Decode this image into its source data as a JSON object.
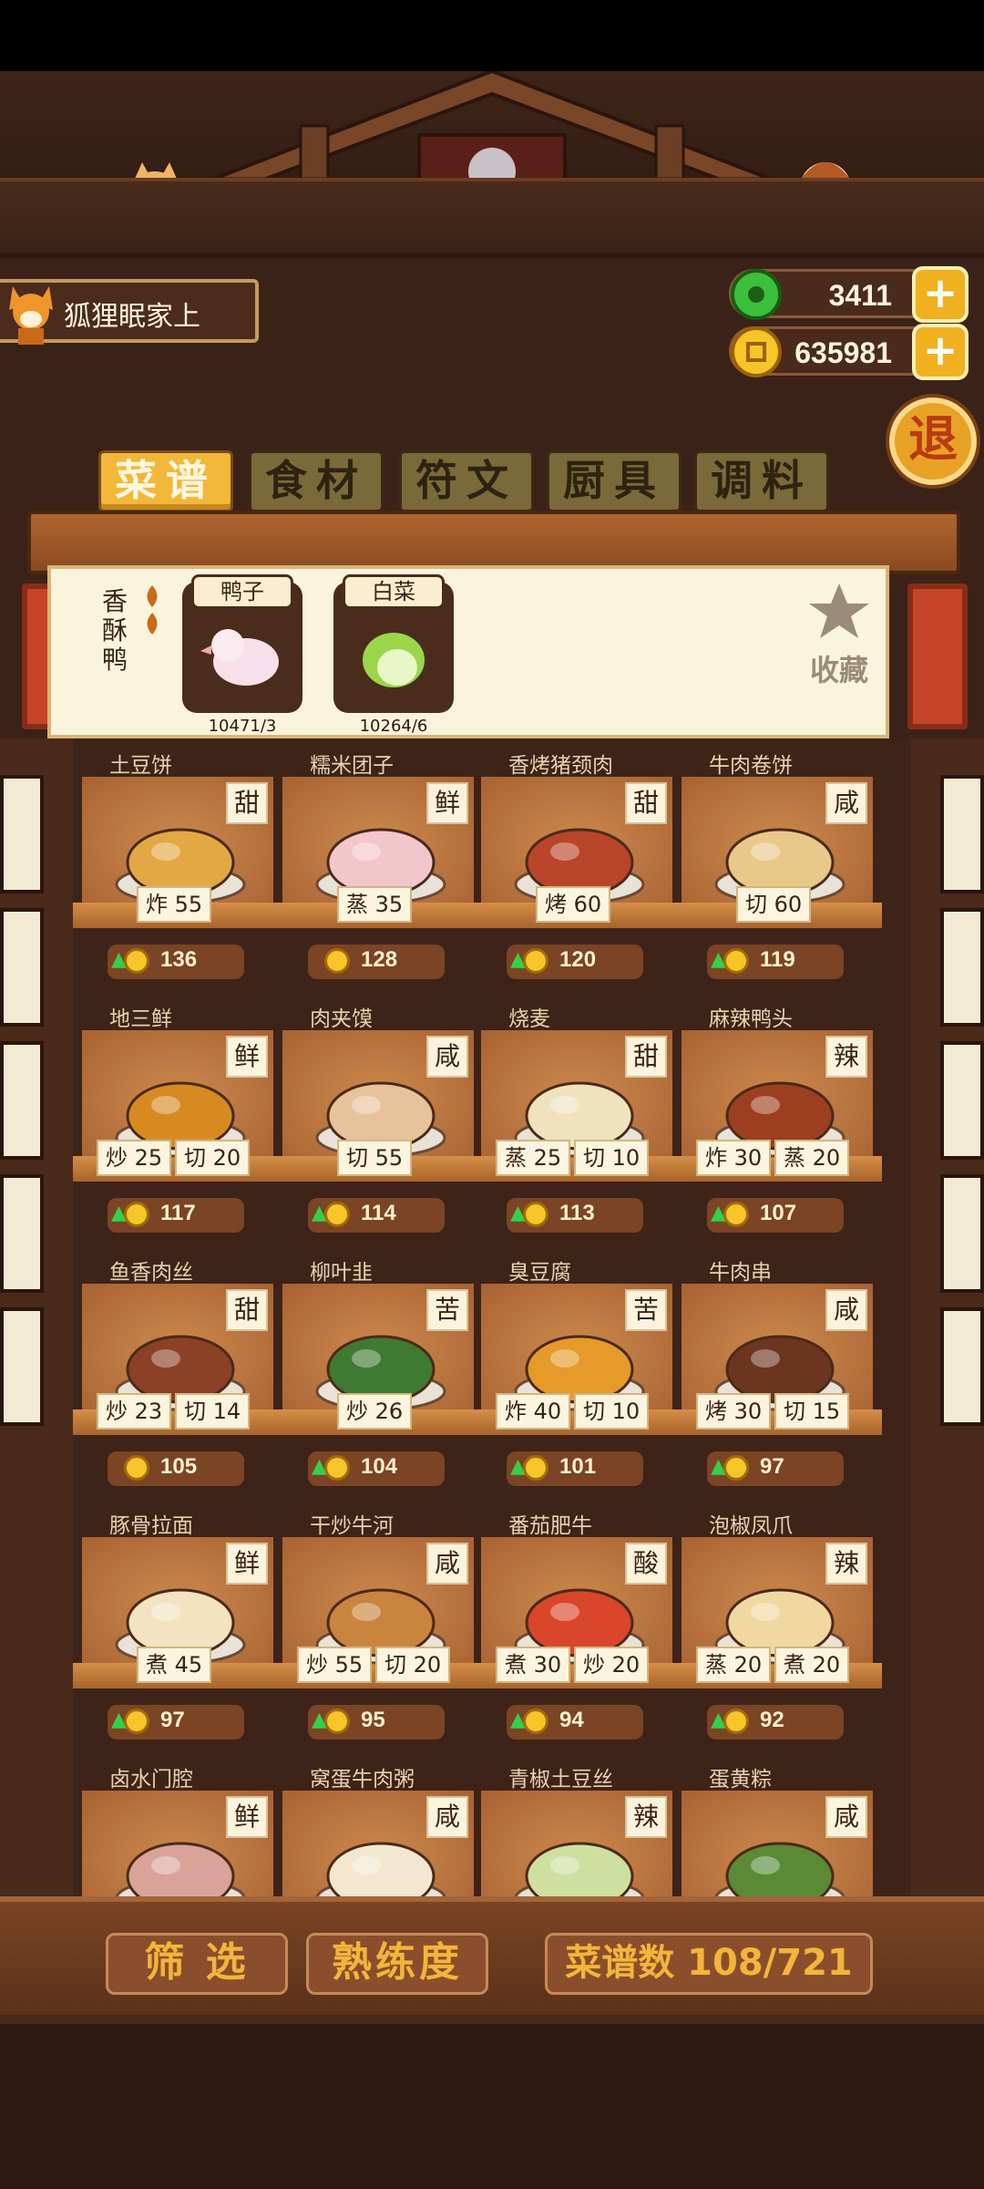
{
  "shop": {
    "name": "狐狸眠家上"
  },
  "currency": {
    "gems": "3411",
    "coins": "635981",
    "add_label": "+"
  },
  "exit_label": "退",
  "tabs": [
    {
      "label": "菜谱",
      "active": true
    },
    {
      "label": "食材",
      "active": false
    },
    {
      "label": "符文",
      "active": false
    },
    {
      "label": "厨具",
      "active": false
    },
    {
      "label": "调料",
      "active": false
    }
  ],
  "selected": {
    "dish": "香酥鸭",
    "ingredients": [
      {
        "name": "鸭子",
        "count": "10471/3",
        "icon": "duck-icon"
      },
      {
        "name": "白菜",
        "count": "10264/6",
        "icon": "cabbage-icon"
      }
    ],
    "favorite_label": "收藏"
  },
  "recipes": [
    {
      "name": "土豆饼",
      "flavor": "甜",
      "tags": [
        "炸 55"
      ],
      "price": "136",
      "up": true,
      "color": "#e2a843"
    },
    {
      "name": "糯米团子",
      "flavor": "鲜",
      "tags": [
        "蒸 35"
      ],
      "price": "128",
      "up": false,
      "color": "#f2c7cc"
    },
    {
      "name": "香烤猪颈肉",
      "flavor": "甜",
      "tags": [
        "烤 60"
      ],
      "price": "120",
      "up": true,
      "color": "#b8452a"
    },
    {
      "name": "牛肉卷饼",
      "flavor": "咸",
      "tags": [
        "切 60"
      ],
      "price": "119",
      "up": true,
      "color": "#e9c98a"
    },
    {
      "name": "地三鲜",
      "flavor": "鲜",
      "tags": [
        "炒 25",
        "切 20"
      ],
      "price": "117",
      "up": true,
      "color": "#d88a22"
    },
    {
      "name": "肉夹馍",
      "flavor": "咸",
      "tags": [
        "切 55"
      ],
      "price": "114",
      "up": true,
      "color": "#e6c39a"
    },
    {
      "name": "烧麦",
      "flavor": "甜",
      "tags": [
        "蒸 25",
        "切 10"
      ],
      "price": "113",
      "up": true,
      "color": "#efe2bd"
    },
    {
      "name": "麻辣鸭头",
      "flavor": "辣",
      "tags": [
        "炸 30",
        "蒸 20"
      ],
      "price": "107",
      "up": true,
      "color": "#9c3f1f"
    },
    {
      "name": "鱼香肉丝",
      "flavor": "甜",
      "tags": [
        "炒 23",
        "切 14"
      ],
      "price": "105",
      "up": false,
      "color": "#8a4126"
    },
    {
      "name": "柳叶韭",
      "flavor": "苦",
      "tags": [
        "炒 26"
      ],
      "price": "104",
      "up": true,
      "color": "#3f7a32"
    },
    {
      "name": "臭豆腐",
      "flavor": "苦",
      "tags": [
        "炸 40",
        "切 10"
      ],
      "price": "101",
      "up": true,
      "color": "#e59a2a"
    },
    {
      "name": "牛肉串",
      "flavor": "咸",
      "tags": [
        "烤 30",
        "切 15"
      ],
      "price": "97",
      "up": true,
      "color": "#6b3520"
    },
    {
      "name": "豚骨拉面",
      "flavor": "鲜",
      "tags": [
        "煮 45"
      ],
      "price": "97",
      "up": true,
      "color": "#f3e3c0"
    },
    {
      "name": "干炒牛河",
      "flavor": "咸",
      "tags": [
        "炒 55",
        "切 20"
      ],
      "price": "95",
      "up": true,
      "color": "#c9843e"
    },
    {
      "name": "番茄肥牛",
      "flavor": "酸",
      "tags": [
        "煮 30",
        "炒 20"
      ],
      "price": "94",
      "up": true,
      "color": "#d9462a"
    },
    {
      "name": "泡椒凤爪",
      "flavor": "辣",
      "tags": [
        "蒸 20",
        "煮 20"
      ],
      "price": "92",
      "up": true,
      "color": "#f0d9a0"
    },
    {
      "name": "卤水门腔",
      "flavor": "鲜",
      "tags": [],
      "price": "",
      "up": false,
      "color": "#d9a39a"
    },
    {
      "name": "窝蛋牛肉粥",
      "flavor": "咸",
      "tags": [],
      "price": "",
      "up": false,
      "color": "#f3e8cf"
    },
    {
      "name": "青椒土豆丝",
      "flavor": "辣",
      "tags": [],
      "price": "",
      "up": false,
      "color": "#cde0a0"
    },
    {
      "name": "蛋黄粽",
      "flavor": "咸",
      "tags": [],
      "price": "",
      "up": false,
      "color": "#5a8a36"
    }
  ],
  "bottom": {
    "filter_label": "筛 选",
    "mastery_label": "熟练度",
    "count_label": "菜谱数 108/721"
  }
}
